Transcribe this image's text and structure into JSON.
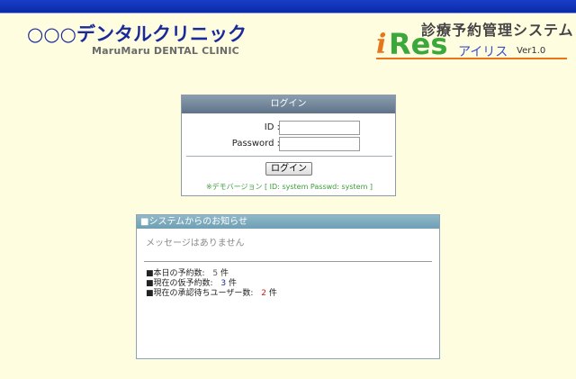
{
  "header": {
    "clinic_name": "○○○デンタルクリニック",
    "clinic_sub": "MaruMaru DENTAL CLINIC",
    "system_title": "診療予約管理システム",
    "logo_i": "i",
    "logo_res": "Res",
    "logo_airisu": "アイリス",
    "logo_version": "Ver1.0"
  },
  "colors": {
    "topbar": "#0a2aa8",
    "background": "#fffde0",
    "logo_orange": "#e8751a",
    "logo_green": "#3aa83a"
  },
  "login": {
    "title": "ログイン",
    "id_label": "ID :",
    "id_value": "",
    "password_label": "Password :",
    "password_value": "",
    "button_label": "ログイン",
    "demo_note": "※デモバージョン [ ID: system   Passwd: system ]"
  },
  "notice": {
    "title": "■システムからのお知らせ",
    "message": "メッセージはありません",
    "stats": [
      {
        "label": "■本日の予約数:",
        "value": "5",
        "unit": "件",
        "color": "#555555"
      },
      {
        "label": "■現在の仮予約数:",
        "value": "3",
        "unit": "件",
        "color": "#1a2a9a"
      },
      {
        "label": "■現在の承認待ちユーザー数:",
        "value": "2",
        "unit": "件",
        "color": "#cc1a1a"
      }
    ]
  }
}
